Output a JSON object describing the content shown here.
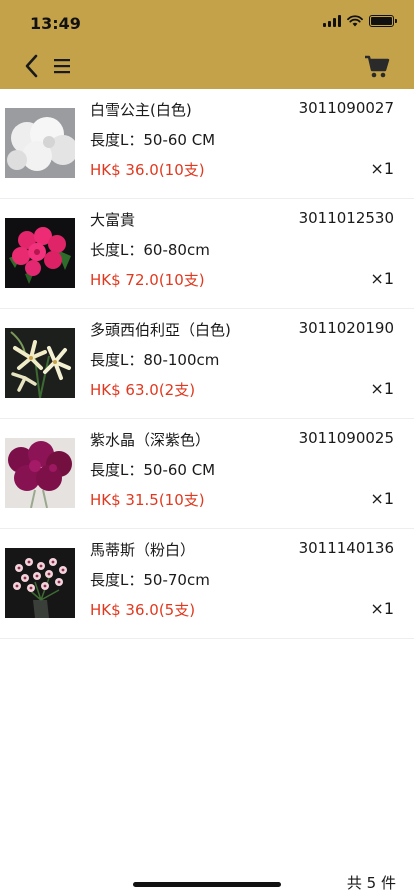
{
  "status_bar": {
    "time": "13:49"
  },
  "colors": {
    "header": "#c4a24a",
    "price": "#e0391f",
    "divider": "#eeeeee"
  },
  "nav": {
    "back_icon": "chevron-left-icon",
    "menu_icon": "hamburger-menu-icon",
    "cart_icon": "shopping-cart-icon"
  },
  "items": [
    {
      "name": "白雪公主(白色)",
      "code": "3011090027",
      "length": "長度L：50-60 CM",
      "price": "HK$ 36.0(10支)",
      "qty": "×1",
      "image": "white-carnations-photo"
    },
    {
      "name": "大富貴",
      "code": "3011012530",
      "length": "长度L：60-80cm",
      "price": "HK$ 72.0(10支)",
      "qty": "×1",
      "image": "pink-roses-photo"
    },
    {
      "name": "多頭西伯利亞（白色)",
      "code": "3011020190",
      "length": "長度L：80-100cm",
      "price": "HK$ 63.0(2支)",
      "qty": "×1",
      "image": "white-lilies-photo"
    },
    {
      "name": "紫水晶（深紫色）",
      "code": "3011090025",
      "length": "長度L：50-60 CM",
      "price": "HK$ 31.5(10支)",
      "qty": "×1",
      "image": "purple-carnations-photo"
    },
    {
      "name": "馬蒂斯（粉白）",
      "code": "3011140136",
      "length": "長度L：50-70cm",
      "price": "HK$ 36.0(5支)",
      "qty": "×1",
      "image": "pink-daisies-photo"
    }
  ],
  "footer": {
    "total": "共 5 件"
  }
}
